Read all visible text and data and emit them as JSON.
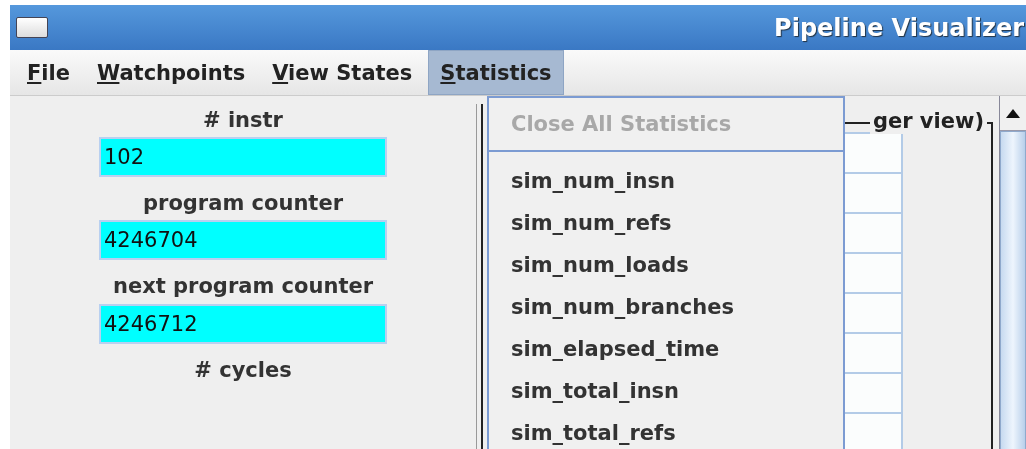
{
  "window": {
    "title": "Pipeline Visualizer"
  },
  "menu_bar": [
    {
      "label": "File",
      "selected": false
    },
    {
      "label": "Watchpoints",
      "selected": false
    },
    {
      "label": "View States",
      "selected": false
    },
    {
      "label": "Statistics",
      "selected": true
    }
  ],
  "left_panel": [
    {
      "kind": "label",
      "text": "# instr"
    },
    {
      "kind": "field",
      "text": "102"
    },
    {
      "kind": "label",
      "text": "program counter"
    },
    {
      "kind": "field",
      "text": "4246704"
    },
    {
      "kind": "label",
      "text": "next program counter"
    },
    {
      "kind": "field",
      "text": "4246712"
    },
    {
      "kind": "label",
      "text": "# cycles"
    }
  ],
  "group_box": {
    "title": "ger view)"
  },
  "statistics_menu": [
    {
      "label": "Close All Statistics",
      "disabled": true,
      "kind": "item"
    },
    {
      "kind": "separator"
    },
    {
      "label": "sim_num_insn",
      "disabled": false,
      "kind": "item"
    },
    {
      "label": "sim_num_refs",
      "disabled": false,
      "kind": "item"
    },
    {
      "label": "sim_num_loads",
      "disabled": false,
      "kind": "item"
    },
    {
      "label": "sim_num_branches",
      "disabled": false,
      "kind": "item"
    },
    {
      "label": "sim_elapsed_time",
      "disabled": false,
      "kind": "item"
    },
    {
      "label": "sim_total_insn",
      "disabled": false,
      "kind": "item"
    },
    {
      "label": "sim_total_refs",
      "disabled": false,
      "kind": "item"
    }
  ]
}
